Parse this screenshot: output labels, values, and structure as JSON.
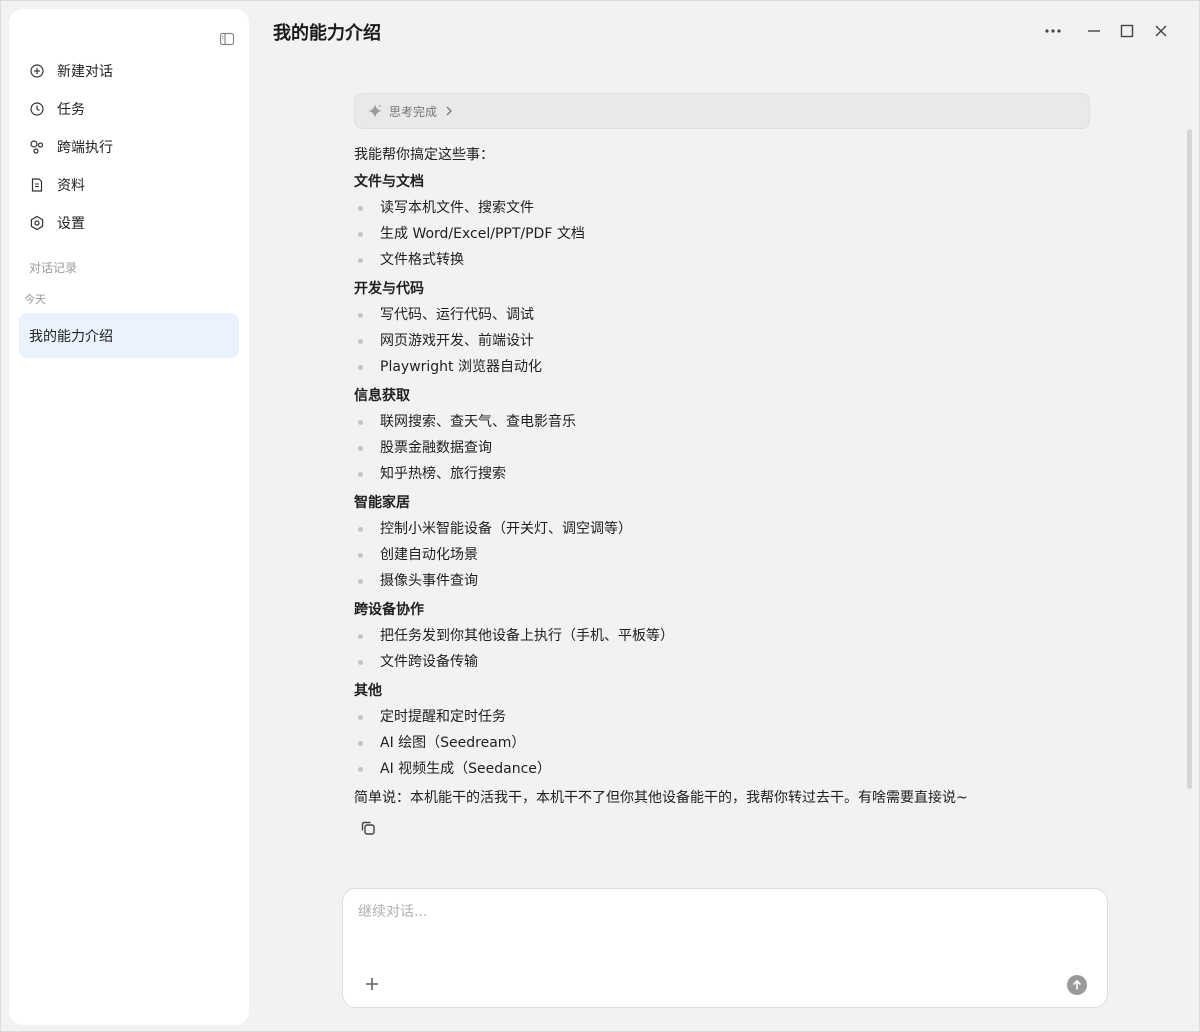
{
  "window": {
    "title": "我的能力介绍"
  },
  "sidebar": {
    "nav": [
      {
        "label": "新建对话",
        "icon": "plus-circle-icon"
      },
      {
        "label": "任务",
        "icon": "clock-icon"
      },
      {
        "label": "跨端执行",
        "icon": "devices-icon"
      },
      {
        "label": "资料",
        "icon": "document-icon"
      },
      {
        "label": "设置",
        "icon": "gear-icon"
      }
    ],
    "section_label": "对话记录",
    "day_label": "今天",
    "conversations": [
      {
        "label": "我的能力介绍"
      }
    ]
  },
  "message": {
    "thinking_label": "思考完成",
    "intro": "我能帮你搞定这些事：",
    "categories": [
      {
        "title": "文件与文档",
        "items": [
          "读写本机文件、搜索文件",
          "生成 Word/Excel/PPT/PDF 文档",
          "文件格式转换"
        ]
      },
      {
        "title": "开发与代码",
        "items": [
          "写代码、运行代码、调试",
          "网页游戏开发、前端设计",
          "Playwright 浏览器自动化"
        ]
      },
      {
        "title": "信息获取",
        "items": [
          "联网搜索、查天气、查电影音乐",
          "股票金融数据查询",
          "知乎热榜、旅行搜索"
        ]
      },
      {
        "title": "智能家居",
        "items": [
          "控制小米智能设备（开关灯、调空调等）",
          "创建自动化场景",
          "摄像头事件查询"
        ]
      },
      {
        "title": "跨设备协作",
        "items": [
          "把任务发到你其他设备上执行（手机、平板等）",
          "文件跨设备传输"
        ]
      },
      {
        "title": "其他",
        "items": [
          "定时提醒和定时任务",
          "AI 绘图（Seedream）",
          "AI 视频生成（Seedance）"
        ]
      }
    ],
    "summary": "简单说：本机能干的活我干，本机干不了但你其他设备能干的，我帮你转过去干。有啥需要直接说~"
  },
  "composer": {
    "placeholder": "继续对话...",
    "value": ""
  },
  "colors": {
    "accent_selected": "#eaf2fd",
    "background": "#f2f2f2",
    "send_button": "#9a9a9a"
  }
}
